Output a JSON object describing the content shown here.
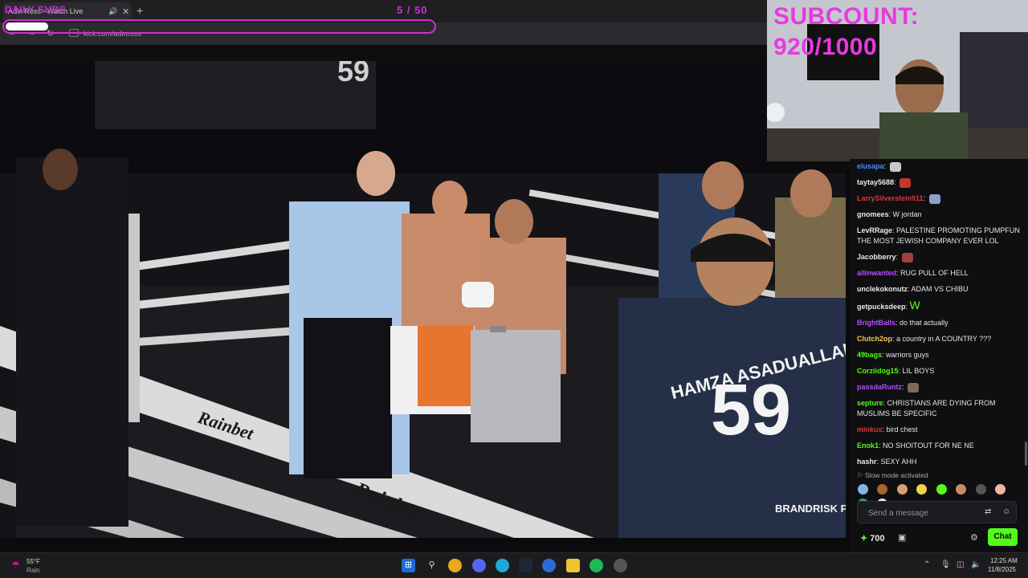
{
  "browser": {
    "tab_title": "Adin Ross - Watch Live",
    "url": "kick.com/adinross"
  },
  "overlay": {
    "goal_label": "DAILY SUBS",
    "goal_current": 5,
    "goal_total": 50,
    "goal_text": "5 / 50",
    "subcount_text": "SUBCOUNT: 920/1000"
  },
  "video": {
    "trunks_text": "HAMZA ASADUALLAH",
    "jersey_number": "59",
    "sponsor": "Rainbet",
    "logo": "BRANDRISK PROMOTIONS"
  },
  "chat": {
    "messages": [
      {
        "user": "elusapa",
        "text": "",
        "color": "#4a8cff",
        "emote": "#c9c9c9"
      },
      {
        "user": "taytay5688",
        "text": "",
        "color": "#e9e9e9",
        "emote": "#c0392b"
      },
      {
        "user": "LarrySilverstein911",
        "text": "",
        "color": "#d33b3b",
        "emote": "#8da0c8"
      },
      {
        "user": "gnomees",
        "text": "W jordan",
        "color": "#e9e9e9",
        "emote": ""
      },
      {
        "user": "LevRRage",
        "text": "PALESTINE PROMOTING PUMPFUN THE MOST JEWISH COMPANY EVER LOL",
        "color": "#e9e9e9",
        "emote": ""
      },
      {
        "user": "Jacobberry",
        "text": "",
        "color": "#e9e9e9",
        "emote": "#a0413e"
      },
      {
        "user": "allinwanted",
        "text": "RUG PULL OF HELL",
        "color": "#b64dff",
        "emote": ""
      },
      {
        "user": "unclekokonutz",
        "text": "ADAM VS CHIBU",
        "color": "#e9e9e9",
        "emote": ""
      },
      {
        "user": "getpucksdeep",
        "text": "W",
        "color": "#e9e9e9",
        "emote": ""
      },
      {
        "user": "BrightBalls",
        "text": "do that actually",
        "color": "#b64dff",
        "emote": ""
      },
      {
        "user": "Clutch2op",
        "text": "a country in A COUNTRY ???",
        "color": "#f2c94c",
        "emote": ""
      },
      {
        "user": "49bags",
        "text": "warriors guys",
        "color": "#53fc18",
        "emote": ""
      },
      {
        "user": "Corziidog15",
        "text": "LIL BOYS",
        "color": "#53fc18",
        "emote": ""
      },
      {
        "user": "passdaRuntz",
        "text": "",
        "color": "#b64dff",
        "emote": "#7a6a5a"
      },
      {
        "user": "septure",
        "text": "CHRISTIANS ARE DYING FROM MUSLIMS BE SPECIFIC",
        "color": "#53fc18",
        "emote": ""
      },
      {
        "user": "minkus",
        "text": "bird chest",
        "color": "#d33b3b",
        "emote": ""
      },
      {
        "user": "Enok1",
        "text": "NO SHOITOUT FOR NE NE",
        "color": "#53fc18",
        "emote": ""
      },
      {
        "user": "hashr",
        "text": "SEXY AHH",
        "color": "#e9e9e9",
        "emote": ""
      }
    ],
    "slow_mode": "Slow mode activated",
    "input_placeholder": "Send a message",
    "points": "700",
    "chat_button": "Chat"
  },
  "taskbar": {
    "temperature": "55°F",
    "weather": "Rain",
    "time": "12:25 AM",
    "date": "11/8/2025"
  },
  "colors": {
    "kick_green": "#53fc18",
    "overlay_magenta": "#d42bd6"
  },
  "icons": [
    "back-icon",
    "forward-icon",
    "reload-icon",
    "audio-icon",
    "close-icon",
    "plus-icon",
    "emote-icon",
    "smile-icon",
    "gift-icon",
    "gear-icon",
    "windows-icon",
    "search-icon",
    "chrome-icon",
    "discord-icon",
    "edge-icon",
    "steam-icon",
    "folder-icon",
    "spotify-icon",
    "wifi-icon",
    "speaker-icon"
  ]
}
